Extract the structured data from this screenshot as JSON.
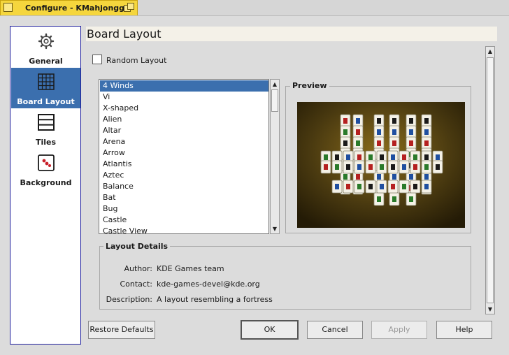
{
  "window": {
    "title": "Configure - KMahjongg"
  },
  "sidebar": {
    "items": [
      {
        "label": "General",
        "icon": "gear-icon"
      },
      {
        "label": "Board Layout",
        "icon": "grid-icon",
        "selected": true
      },
      {
        "label": "Tiles",
        "icon": "tiles-icon"
      },
      {
        "label": "Background",
        "icon": "background-icon"
      }
    ]
  },
  "page": {
    "heading": "Board Layout",
    "random_layout": {
      "label": "Random Layout",
      "checked": false
    },
    "layouts": [
      "4 Winds",
      "Vi",
      "X-shaped",
      "Alien",
      "Altar",
      "Arena",
      "Arrow",
      "Atlantis",
      "Aztec",
      "Balance",
      "Bat",
      "Bug",
      "Castle",
      "Castle View"
    ],
    "selected_layout": "4 Winds",
    "preview": {
      "title": "Preview"
    },
    "details": {
      "title": "Layout Details",
      "author_label": "Author:",
      "author": "KDE Games team",
      "contact_label": "Contact:",
      "contact": "kde-games-devel@kde.org",
      "description_label": "Description:",
      "description": "A layout resembling a fortress"
    }
  },
  "buttons": {
    "restore_defaults": "Restore Defaults",
    "ok": "OK",
    "cancel": "Cancel",
    "apply": "Apply",
    "help": "Help"
  },
  "colors": {
    "selection": "#3b6fae",
    "title_bar": "#f5d63d",
    "sidebar_border": "#1e1e9c"
  }
}
